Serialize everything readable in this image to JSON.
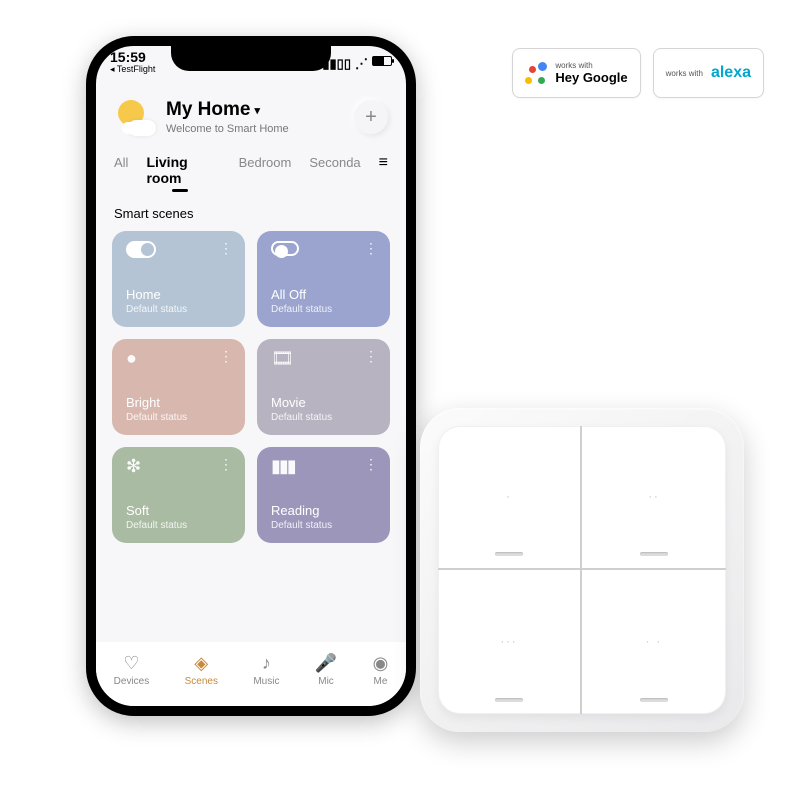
{
  "statusbar": {
    "time": "15:59",
    "back_app": "◂ TestFlight"
  },
  "header": {
    "title": "My Home",
    "subtitle": "Welcome to Smart Home",
    "add_label": "+"
  },
  "tabs": {
    "items": [
      "All",
      "Living room",
      "Bedroom",
      "Seconda"
    ],
    "active_index": 1
  },
  "section_title": "Smart scenes",
  "scenes": [
    {
      "name": "Home",
      "status": "Default status",
      "color": "#b4c4d4",
      "icon": "toggle-on"
    },
    {
      "name": "All Off",
      "status": "Default status",
      "color": "#9aa4ce",
      "icon": "toggle-off"
    },
    {
      "name": "Bright",
      "status": "Default status",
      "color": "#d8b8ae",
      "icon": "bulb"
    },
    {
      "name": "Movie",
      "status": "Default status",
      "color": "#b8b3c1",
      "icon": "film"
    },
    {
      "name": "Soft",
      "status": "Default status",
      "color": "#a9bba2",
      "icon": "sparkle"
    },
    {
      "name": "Reading",
      "status": "Default status",
      "color": "#9d96bb",
      "icon": "books"
    }
  ],
  "bottom_nav": {
    "items": [
      "Devices",
      "Scenes",
      "Music",
      "Mic",
      "Me"
    ],
    "active_index": 1
  },
  "switch_panel": {
    "buttons": [
      "·",
      "··",
      "···",
      "· ·"
    ]
  },
  "badges": {
    "google": {
      "prefix": "works with",
      "brand": "Hey Google"
    },
    "alexa": {
      "prefix": "works with",
      "brand": "alexa"
    }
  }
}
